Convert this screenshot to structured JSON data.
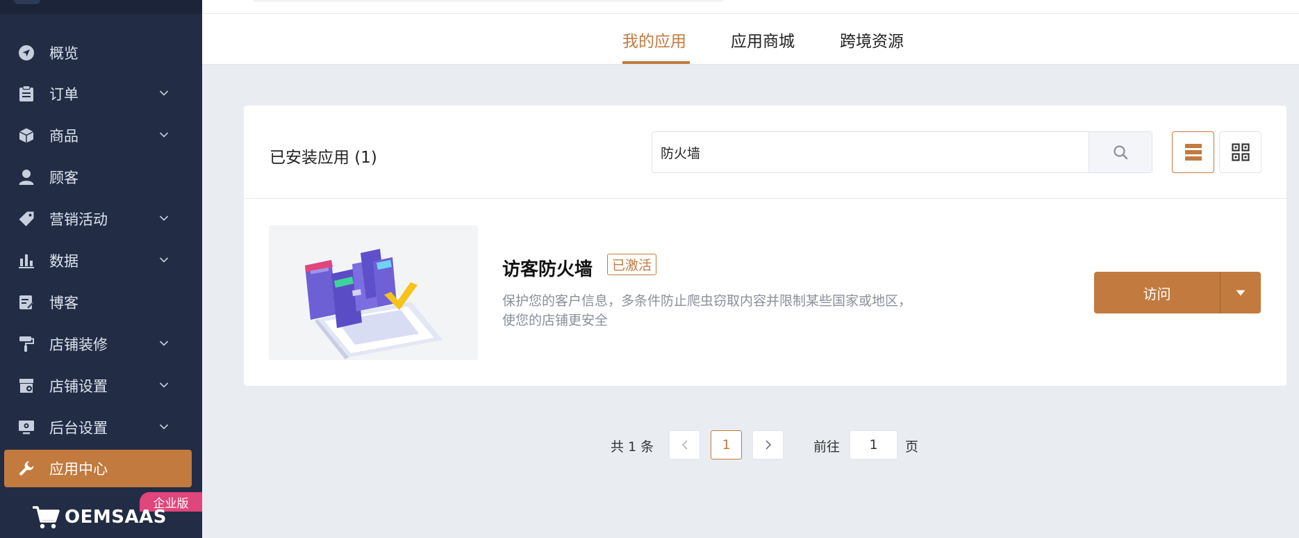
{
  "sidebar": {
    "items": [
      {
        "label": "概览",
        "icon": "send-icon",
        "has_children": false
      },
      {
        "label": "订单",
        "icon": "clipboard-icon",
        "has_children": true
      },
      {
        "label": "商品",
        "icon": "box-icon",
        "has_children": true
      },
      {
        "label": "顾客",
        "icon": "user-icon",
        "has_children": false
      },
      {
        "label": "营销活动",
        "icon": "tag-icon",
        "has_children": true
      },
      {
        "label": "数据",
        "icon": "bar-chart-icon",
        "has_children": true
      },
      {
        "label": "博客",
        "icon": "edit-note-icon",
        "has_children": false
      },
      {
        "label": "店铺装修",
        "icon": "paint-roller-icon",
        "has_children": true
      },
      {
        "label": "店铺设置",
        "icon": "store-settings-icon",
        "has_children": true
      },
      {
        "label": "后台设置",
        "icon": "monitor-settings-icon",
        "has_children": true
      },
      {
        "label": "应用中心",
        "icon": "wrench-icon",
        "has_children": false,
        "active": true
      }
    ],
    "brand": {
      "name": "OEMSAAS",
      "edition_badge": "企业版"
    }
  },
  "tabs": [
    {
      "label": "我的应用",
      "active": true
    },
    {
      "label": "应用商城",
      "active": false
    },
    {
      "label": "跨境资源",
      "active": false
    }
  ],
  "installed": {
    "title": "已安装应用 (1)",
    "search_value": "防火墙",
    "view_mode": "list"
  },
  "app": {
    "name": "访客防火墙",
    "status": "已激活",
    "description_line1": "保护您的客户信息，多条件防止爬虫窃取内容并限制某些国家或地区，",
    "description_line2": "使您的店铺更安全",
    "visit_label": "访问"
  },
  "pagination": {
    "total_text": "共 1 条",
    "current_page": "1",
    "goto_label": "前往",
    "goto_value": "1",
    "page_suffix": "页"
  },
  "colors": {
    "accent": "#c27a3e",
    "sidebar_bg": "#222d45",
    "badge": "#e0457b"
  }
}
